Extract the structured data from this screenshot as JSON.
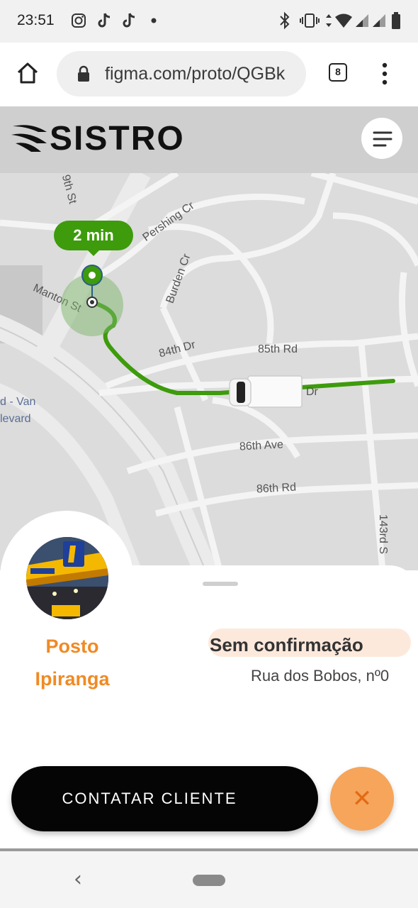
{
  "status_bar": {
    "time": "23:51",
    "left_icons": [
      "instagram-icon",
      "tiktok-icon",
      "tiktok-icon",
      "dot-icon"
    ],
    "right_icons": [
      "bluetooth-icon",
      "vibrate-icon",
      "data-arrows-icon",
      "wifi-icon",
      "signal-icon",
      "signal-icon",
      "battery-icon"
    ]
  },
  "browser": {
    "url": "figma.com/proto/QGBk",
    "tab_count": "8",
    "icons": [
      "home-icon",
      "lock-icon",
      "more-vert-icon"
    ]
  },
  "app": {
    "logo_text": "SISTRO",
    "menu_icon": "menu-icon"
  },
  "map": {
    "eta": "2 min",
    "streets": [
      "9th St",
      "Pershing Cr",
      "Burden Cr",
      "Manton St",
      "84th Dr",
      "85th Rd",
      "Dr",
      "86th Ave",
      "86th Rd",
      "143rd S",
      "d - Van",
      "levard"
    ],
    "route_color": "#3d9b0c"
  },
  "destination": {
    "name_line1": "Posto",
    "name_line2": "Ipiranga",
    "status": "Sem confirmação",
    "address": "Rua dos Bobos, nº0"
  },
  "actions": {
    "contact_label": "CONTATAR CLIENTE",
    "cancel_icon": "close-icon",
    "cancel_symbol": "✕"
  },
  "nav_bar": {
    "back_symbol": "‹"
  },
  "colors": {
    "accent_orange": "#f08a24",
    "route_green": "#3d9b0c",
    "button_black": "#050505",
    "cancel_orange": "#f6a55a"
  }
}
